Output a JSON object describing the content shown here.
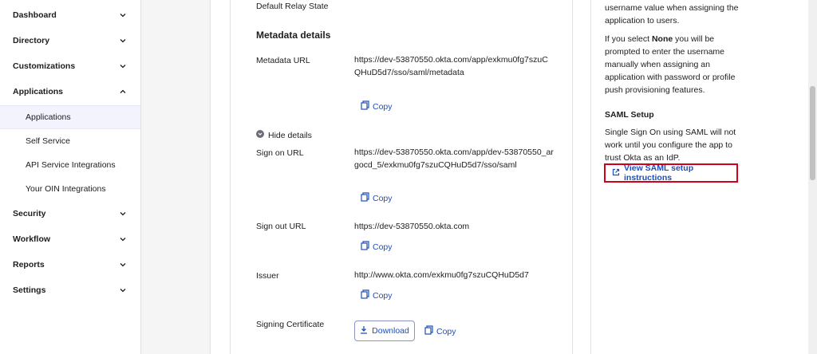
{
  "sidebar": {
    "items": [
      {
        "label": "Dashboard"
      },
      {
        "label": "Directory"
      },
      {
        "label": "Customizations"
      },
      {
        "label": "Applications"
      },
      {
        "label": "Security"
      },
      {
        "label": "Workflow"
      },
      {
        "label": "Reports"
      },
      {
        "label": "Settings"
      }
    ],
    "applications_sub": [
      {
        "label": "Applications"
      },
      {
        "label": "Self Service"
      },
      {
        "label": "API Service Integrations"
      },
      {
        "label": "Your OIN Integrations"
      }
    ]
  },
  "main": {
    "default_relay_state": "Default Relay State",
    "metadata_heading": "Metadata details",
    "metadata_url_label": "Metadata URL",
    "metadata_url": "https://dev-53870550.okta.com/app/exkmu0fg7szuCQHuD5d7/sso/saml/metadata",
    "copy_label": "Copy",
    "hide_details": "Hide details",
    "sign_on_label": "Sign on URL",
    "sign_on_url": "https://dev-53870550.okta.com/app/dev-53870550_argocd_5/exkmu0fg7szuCQHuD5d7/sso/saml",
    "sign_out_label": "Sign out URL",
    "sign_out_url": "https://dev-53870550.okta.com",
    "issuer_label": "Issuer",
    "issuer": "http://www.okta.com/exkmu0fg7szuCQHuD5d7",
    "signing_cert_label": "Signing Certificate",
    "download_label": "Download"
  },
  "right": {
    "para1": "username value when assigning the application to users.",
    "para2_prefix": "If you select ",
    "para2_bold": "None",
    "para2_suffix": " you will be prompted to enter the username manually when assigning an application with password or profile push provisioning features.",
    "saml_heading": "SAML Setup",
    "saml_text": "Single Sign On using SAML will not work until you configure the app to trust Okta as an IdP.",
    "saml_link": "View SAML setup instructions"
  },
  "colors": {
    "link": "#1f4fb8",
    "highlight": "#d0021b",
    "active_bg": "#f2f3fd"
  }
}
